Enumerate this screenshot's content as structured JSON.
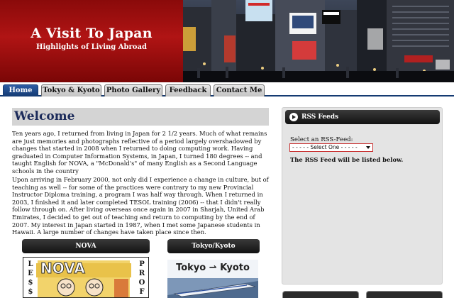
{
  "header": {
    "title": "A Visit To Japan",
    "subtitle": "Highlights of Living Abroad"
  },
  "nav": {
    "tabs": [
      {
        "label": "Home",
        "active": true
      },
      {
        "label": "Tokyo & Kyoto",
        "active": false
      },
      {
        "label": "Photo Gallery",
        "active": false
      },
      {
        "label": "Feedback",
        "active": false
      },
      {
        "label": "Contact Me",
        "active": false
      }
    ]
  },
  "main": {
    "heading": "Welcome",
    "paragraphs": [
      "Ten years ago, I returned from living in Japan for 2 1/2 years. Much of what remains are just memories and photographs reflective of a period largely overshadowed by changes that started in 2008 when I returned to doing computing work. Having graduated in Computer Information Systems, in Japan, I turned 180 degrees -- and taught English for NOVA, a \"McDonald's\" of many English as a Second Language schools in the country",
      "Upon arriving in February 2000, not only did I experience a change in culture, but of teaching as well -- for some of the practices were contrary to my new Provincial Instructor Diploma training, a program I was half way through. When I returned in 2003, I finished it and later completed TESOL training (2006) -- that I didn't really follow through on. After living overseas once again in 2007 in Sharjah, United Arab Emirates, I decided to get out of teaching and return to computing by the end of 2007. My interest in Japan started in 1987, when I met some Japanese students in Hawaii. A large number of changes have taken place since then."
    ],
    "panels": [
      {
        "label": "NOVA"
      },
      {
        "label": "Tokyo/Kyoto"
      }
    ],
    "nova_image": {
      "logo_text": "NOVA",
      "left_letters": [
        "L",
        "E",
        "$",
        "$"
      ],
      "right_letters": [
        "P",
        "R",
        "O",
        "F"
      ]
    },
    "tokyo_image": {
      "caption": "Tokyo ⇀ Kyoto"
    }
  },
  "sidebar": {
    "rss_title": "RSS Feeds",
    "select_label": "Select an RSS-Feed:",
    "select_value": "- - - - - Select One - - - - -",
    "note": "The RSS Feed will be listed below."
  },
  "colors": {
    "brand_red": "#a00f0f",
    "nav_active": "#143a72",
    "heading_blue": "#1b2a5a",
    "select_border": "#c83232"
  }
}
